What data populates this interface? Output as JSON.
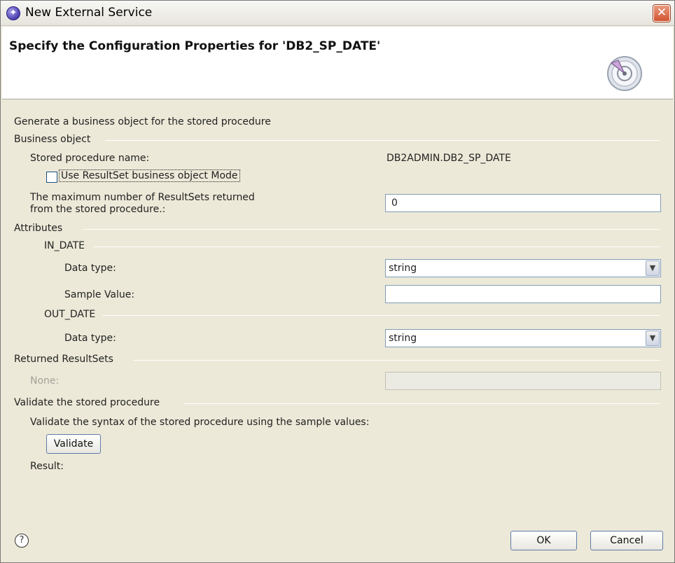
{
  "window": {
    "title": "New External Service"
  },
  "banner": {
    "title": "Specify the Configuration Properties for 'DB2_SP_DATE'"
  },
  "intro": "Generate a business object for the stored procedure",
  "business_object": {
    "group_label": "Business object",
    "sp_name_label": "Stored procedure name:",
    "sp_name_value": "DB2ADMIN.DB2_SP_DATE",
    "resultset_checkbox_label": "Use ResultSet business object Mode",
    "resultset_checkbox_checked": false,
    "max_resultsets_label_line1": "The maximum number of ResultSets returned",
    "max_resultsets_label_line2": "from the stored procedure.:",
    "max_resultsets_value": "0"
  },
  "attributes": {
    "group_label": "Attributes",
    "in_date": {
      "group_label": "IN_DATE",
      "data_type_label": "Data type:",
      "data_type_value": "string",
      "sample_value_label": "Sample Value:",
      "sample_value": ""
    },
    "out_date": {
      "group_label": "OUT_DATE",
      "data_type_label": "Data type:",
      "data_type_value": "string"
    }
  },
  "returned_resultsets": {
    "group_label": "Returned ResultSets",
    "none_label": "None:",
    "none_value": ""
  },
  "validate": {
    "group_label": "Validate the stored procedure",
    "description": "Validate the syntax of the stored procedure using the sample values:",
    "button_label": "Validate",
    "result_label": "Result:"
  },
  "footer": {
    "ok_label": "OK",
    "cancel_label": "Cancel",
    "help_glyph": "?"
  },
  "icons": {
    "app": "eclipse-service-icon",
    "close": "close-icon",
    "banner": "gauge-wizard-icon",
    "help": "help-icon",
    "dropdown": "chevron-down-icon"
  },
  "colors": {
    "window_bg": "#ece9d8",
    "close_button": "#d2532e",
    "field_border": "#7f9db9"
  }
}
